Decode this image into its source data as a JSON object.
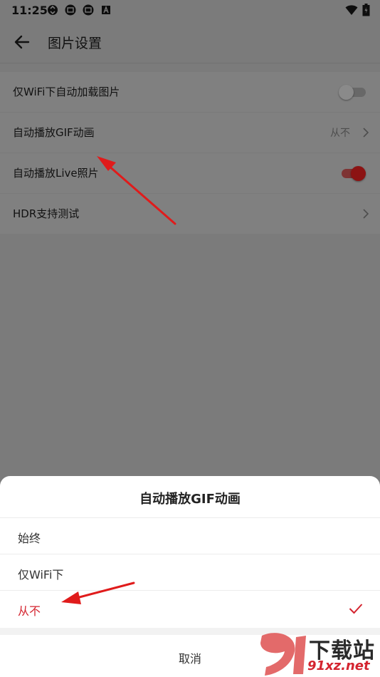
{
  "status_bar": {
    "time": "11:25",
    "icons": [
      "sync-icon",
      "notification-icon",
      "notification-icon-2",
      "a-icon"
    ],
    "right_icons": [
      "wifi-icon",
      "battery-icon"
    ]
  },
  "app_bar": {
    "title": "图片设置",
    "back_icon": "arrow-left-icon"
  },
  "settings": {
    "items": [
      {
        "label": "仅WiFi下自动加载图片",
        "control": "toggle",
        "on": false
      },
      {
        "label": "自动播放GIF动画",
        "control": "value",
        "value": "从不"
      },
      {
        "label": "自动播放Live照片",
        "control": "toggle",
        "on": true
      },
      {
        "label": "HDR支持测试",
        "control": "chevron"
      }
    ]
  },
  "sheet": {
    "title": "自动播放GIF动画",
    "options": [
      {
        "label": "始终",
        "selected": false
      },
      {
        "label": "仅WiFi下",
        "selected": false
      },
      {
        "label": "从不",
        "selected": true
      }
    ],
    "cancel_label": "取消"
  },
  "watermark": {
    "line1": "下载站",
    "line2": "91xz.net"
  },
  "colors": {
    "accent": "#d4242f",
    "overlay": "#7b7b7b",
    "arrow": "#e01b1b"
  }
}
